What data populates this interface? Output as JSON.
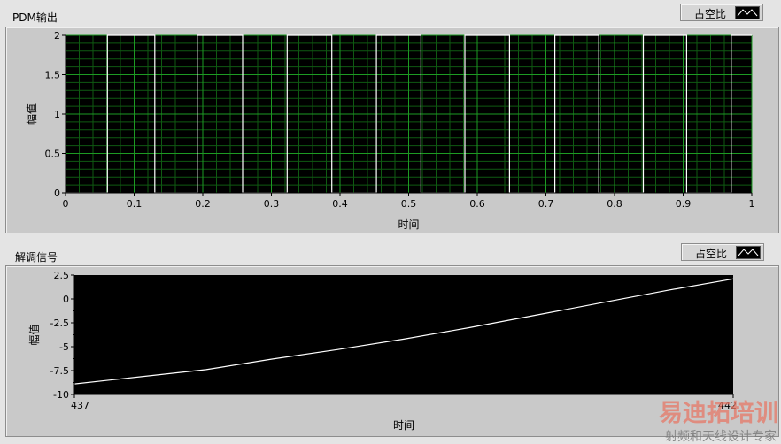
{
  "charts": [
    {
      "title": "PDM输出",
      "legend": {
        "label": "占空比",
        "icon": "line-sample-icon"
      }
    },
    {
      "title": "解调信号",
      "legend": {
        "label": "占空比",
        "icon": "line-sample-icon"
      }
    }
  ],
  "watermark": {
    "brand": "易迪拓培训",
    "tagline": "射频和天线设计专家"
  },
  "chart_data": [
    {
      "type": "line",
      "title": "PDM输出",
      "xlabel": "时间",
      "ylabel": "幅值",
      "xlim": [
        0,
        1
      ],
      "ylim": [
        0,
        2
      ],
      "xticks": [
        "0",
        "0.1",
        "0.2",
        "0.3",
        "0.4",
        "0.5",
        "0.6",
        "0.7",
        "0.8",
        "0.9",
        "1"
      ],
      "yticks": [
        "0",
        "0.5",
        "1",
        "1.5",
        "2"
      ],
      "grid": true,
      "series": [
        {
          "name": "占空比",
          "x": [
            0,
            0.061,
            0.061,
            0.13,
            0.13,
            0.192,
            0.192,
            0.258,
            0.258,
            0.323,
            0.323,
            0.388,
            0.388,
            0.453,
            0.453,
            0.518,
            0.518,
            0.582,
            0.582,
            0.647,
            0.647,
            0.713,
            0.713,
            0.777,
            0.777,
            0.842,
            0.842,
            0.905,
            0.905,
            0.97,
            0.97,
            1
          ],
          "y": [
            0,
            0,
            2,
            2,
            0,
            0,
            2,
            2,
            0,
            0,
            2,
            2,
            0,
            0,
            2,
            2,
            0,
            0,
            2,
            2,
            0,
            0,
            2,
            2,
            0,
            0,
            2,
            2,
            0,
            0,
            2,
            2
          ]
        }
      ]
    },
    {
      "type": "line",
      "title": "解调信号",
      "xlabel": "时间",
      "ylabel": "幅值",
      "xlim": [
        437,
        442
      ],
      "ylim": [
        -10,
        2.5
      ],
      "xticks": [
        "437",
        "442"
      ],
      "yticks": [
        "-10",
        "-7.5",
        "-5",
        "-2.5",
        "0",
        "2.5"
      ],
      "grid": false,
      "series": [
        {
          "name": "占空比",
          "x": [
            437,
            437.5,
            438,
            438.5,
            439,
            439.5,
            440,
            440.5,
            441,
            441.5,
            442
          ],
          "y": [
            -8.9,
            -8.15,
            -7.4,
            -6.3,
            -5.3,
            -4.2,
            -3.0,
            -1.7,
            -0.4,
            0.9,
            2.1
          ]
        }
      ]
    }
  ]
}
